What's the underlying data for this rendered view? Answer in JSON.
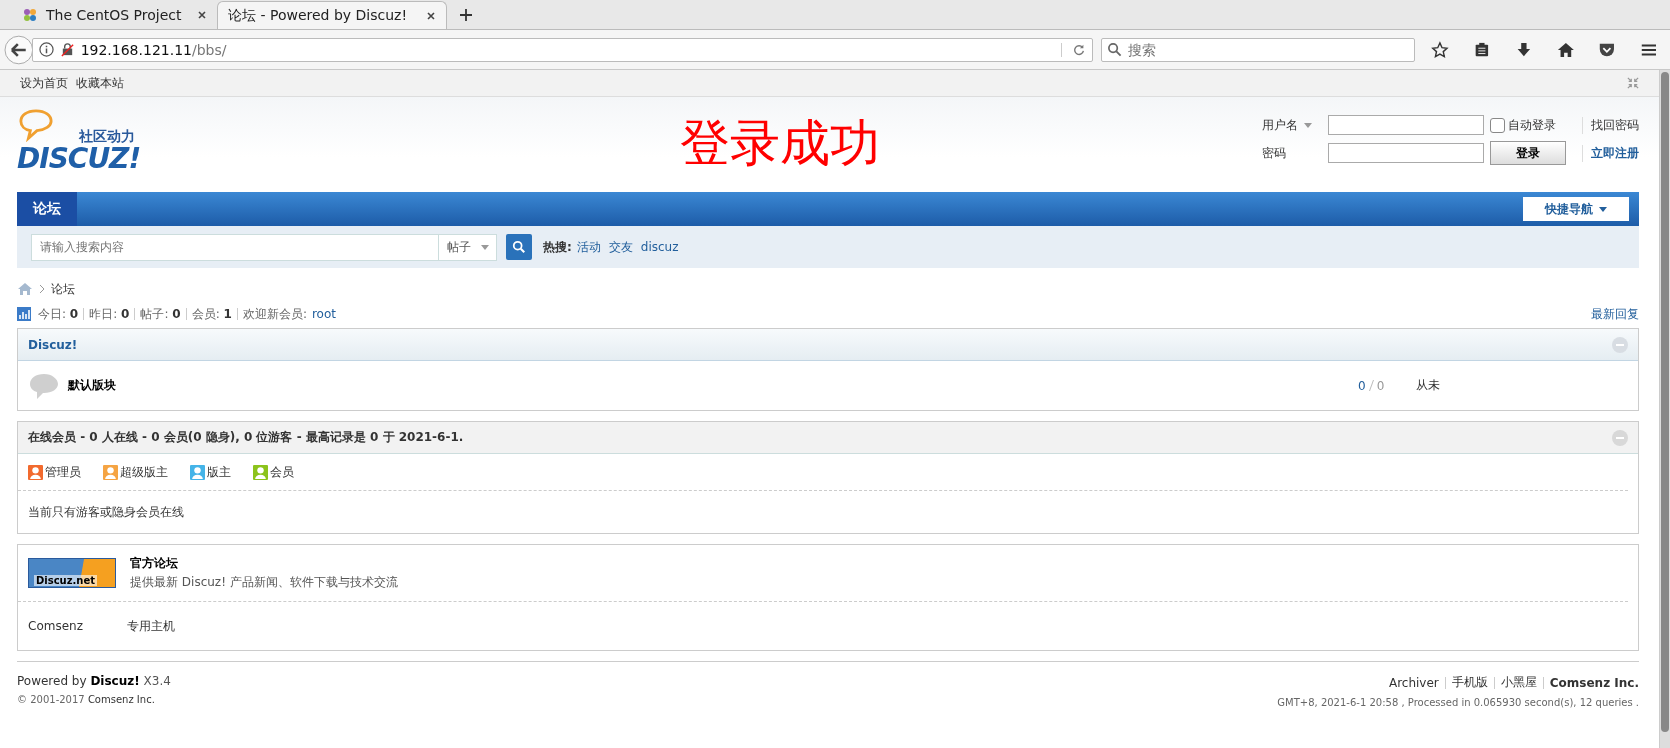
{
  "browser": {
    "tabs": [
      {
        "title": "The CentOS Project",
        "selected": false
      },
      {
        "title": "论坛 - Powered by Discuz!",
        "selected": true
      }
    ],
    "address": {
      "host": "192.168.121.11",
      "path": "/bbs/"
    },
    "search": {
      "placeholder": "搜索"
    },
    "bookmarks": [
      "设为首页",
      "收藏本站"
    ]
  },
  "header": {
    "logo": {
      "tagline": "社区动力",
      "wordmark": "DISCUZ!"
    },
    "banner": "登录成功",
    "login": {
      "username_label": "用户名",
      "password_label": "密码",
      "auto_login": {
        "label": "自动登录",
        "checked": false
      },
      "login_button": "登录",
      "forgot": "找回密码",
      "register": "立即注册"
    }
  },
  "nav": {
    "items": [
      {
        "label": "论坛",
        "selected": true
      }
    ],
    "quick_nav": "快捷导航"
  },
  "search": {
    "placeholder": "请输入搜索内容",
    "type": "帖子",
    "hot_label": "热搜:",
    "hot": [
      "活动",
      "交友",
      "discuz"
    ]
  },
  "breadcrumb": [
    "论坛"
  ],
  "stats": {
    "items": [
      {
        "label": "今日:",
        "value": "0"
      },
      {
        "label": "昨日:",
        "value": "0"
      },
      {
        "label": "帖子:",
        "value": "0"
      },
      {
        "label": "会员:",
        "value": "1"
      }
    ],
    "new_member_label": "欢迎新会员:",
    "new_member": "root",
    "latest_reply": "最新回复"
  },
  "category": {
    "title": "Discuz!",
    "forums": [
      {
        "name": "默认版块",
        "threads": "0",
        "posts": "0",
        "last": "从未"
      }
    ]
  },
  "online": {
    "title": "在线会员 - 0 人在线 - 0 会员(0 隐身), 0 位游客 - 最高记录是 0 于 2021-6-1.",
    "legend": [
      {
        "label": "管理员",
        "color": "#f26a2e"
      },
      {
        "label": "超级版主",
        "color": "#f5a443"
      },
      {
        "label": "版主",
        "color": "#45b4e8"
      },
      {
        "label": "会员",
        "color": "#8cc31c"
      }
    ],
    "note": "当前只有游客或隐身会员在线"
  },
  "links": {
    "featured": {
      "image_text": "Discuz.net",
      "title": "官方论坛",
      "desc": "提供最新 Discuz! 产品新闻、软件下载与技术交流"
    },
    "text_links": [
      "Comsenz",
      "专用主机"
    ]
  },
  "footer": {
    "powered_prefix": "Powered by",
    "product": "Discuz!",
    "version": "X3.4",
    "copyright": "© 2001-2017",
    "company": "Comsenz Inc.",
    "links": [
      {
        "label": "Archiver",
        "bold": false
      },
      {
        "label": "手机版",
        "bold": false
      },
      {
        "label": "小黑屋",
        "bold": false
      },
      {
        "label": "Comsenz Inc.",
        "bold": true
      }
    ],
    "info": "GMT+8, 2021-6-1 20:58 , Processed in 0.065930 second(s), 12 queries ."
  }
}
